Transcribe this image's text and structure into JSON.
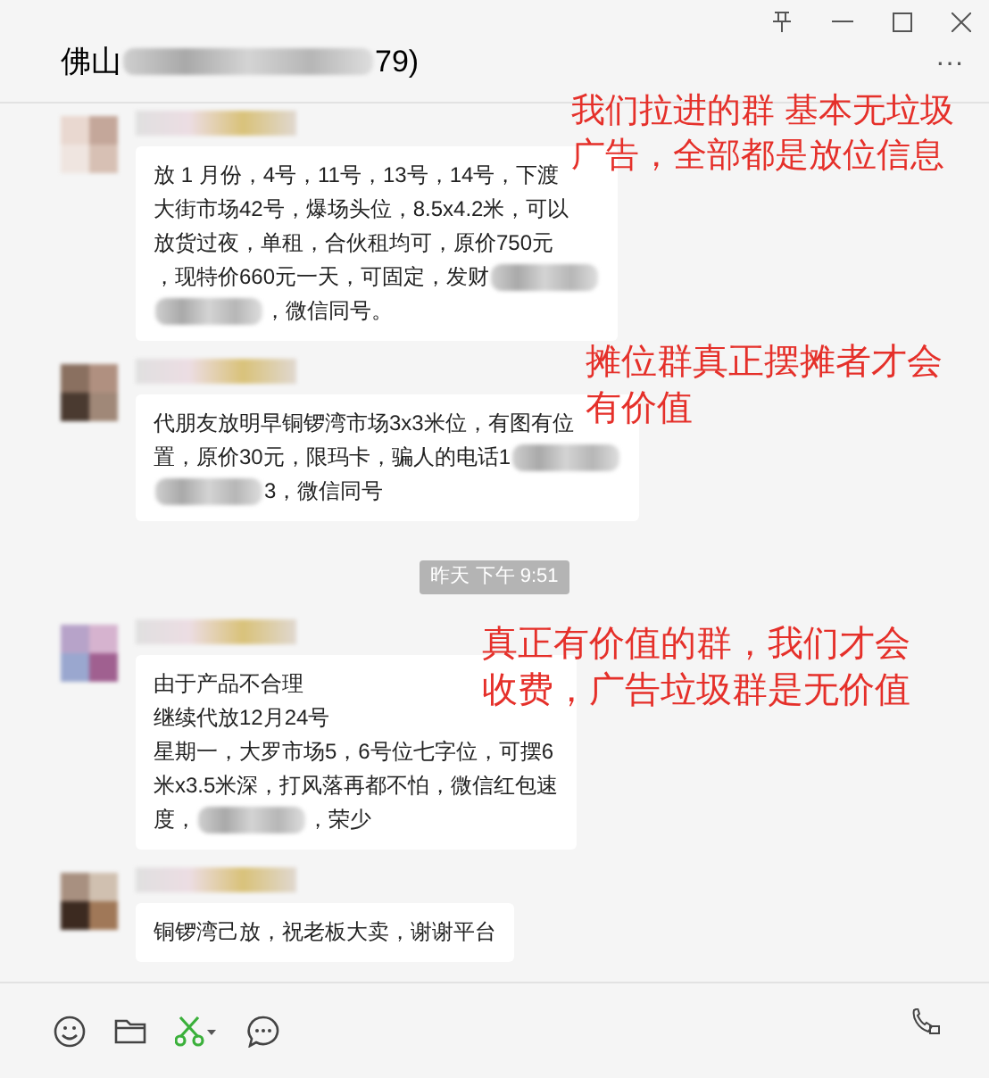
{
  "window": {
    "title": [
      {
        "kind": "text",
        "text": "佛山"
      },
      {
        "kind": "blur"
      },
      {
        "kind": "text",
        "text": "79)"
      }
    ],
    "more": "···"
  },
  "messages": [
    {
      "kind": "message",
      "segments": [
        {
          "kind": "text",
          "text": "放 1 月份，4号，11号，13号，14号，下渡"
        },
        {
          "kind": "break"
        },
        {
          "kind": "text",
          "text": "大街市场42号，爆场头位，8.5x4.2米，可以"
        },
        {
          "kind": "break"
        },
        {
          "kind": "text",
          "text": "放货过夜，单租，合伙租均可，原价750元"
        },
        {
          "kind": "break"
        },
        {
          "kind": "text",
          "text": "，现特价660元一天，可固定，发财"
        },
        {
          "kind": "blur"
        },
        {
          "kind": "break"
        },
        {
          "kind": "blur"
        },
        {
          "kind": "text",
          "text": "，微信同号。"
        }
      ]
    },
    {
      "kind": "message",
      "segments": [
        {
          "kind": "text",
          "text": "代朋友放明早铜锣湾市场3x3米位，有图有位"
        },
        {
          "kind": "break"
        },
        {
          "kind": "text",
          "text": "置，原价30元，限玛卡，骗人的电话1"
        },
        {
          "kind": "blur"
        },
        {
          "kind": "break"
        },
        {
          "kind": "blur"
        },
        {
          "kind": "text",
          "text": "3，微信同号"
        }
      ]
    },
    {
      "kind": "timestamp",
      "text": "昨天 下午 9:51"
    },
    {
      "kind": "message",
      "segments": [
        {
          "kind": "text",
          "text": "由于产品不合理"
        },
        {
          "kind": "break"
        },
        {
          "kind": "text",
          "text": "继续代放12月24号"
        },
        {
          "kind": "break"
        },
        {
          "kind": "text",
          "text": "星期一，大罗市场5，6号位七字位，可摆6"
        },
        {
          "kind": "break"
        },
        {
          "kind": "text",
          "text": "米x3.5米深，打风落再都不怕，微信红包速"
        },
        {
          "kind": "break"
        },
        {
          "kind": "text",
          "text": "度，"
        },
        {
          "kind": "blur"
        },
        {
          "kind": "text",
          "text": "，荣少"
        }
      ]
    },
    {
      "kind": "message",
      "segments": [
        {
          "kind": "text",
          "text": "铜锣湾己放，祝老板大卖，谢谢平台"
        }
      ]
    }
  ],
  "annotations": [
    "我们拉进的群 基本无垃圾广告，全部都是放位信息",
    "摊位群真正摆摊者才会有价值",
    "真正有价值的群，我们才会收费，广告垃圾群是无价值"
  ]
}
